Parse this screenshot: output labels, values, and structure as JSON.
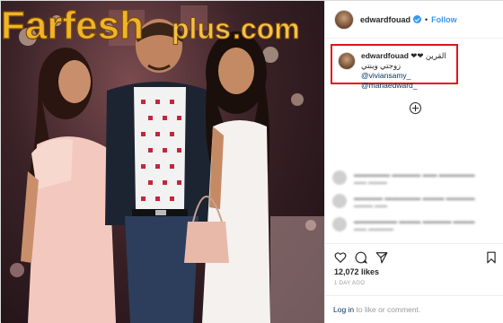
{
  "header": {
    "username": "edwardfouad",
    "separator": "•",
    "follow_label": "Follow"
  },
  "caption": {
    "username": "edwardfouad",
    "text": "القرين ❤❤ زوجتي وبنتي",
    "mention1": "@viviansamy_",
    "mention2": "@mariaedward_"
  },
  "comments": [
    {
      "text": "▬▬▬▬▬ ▬▬▬▬ ▬▬ ▬▬▬▬▬",
      "sub": "▬▬ ▬▬▬"
    },
    {
      "text": "▬▬▬▬ ▬▬▬▬▬ ▬▬▬ ▬▬▬▬",
      "sub": "▬▬▬ ▬▬"
    },
    {
      "text": "▬▬▬▬▬▬ ▬▬▬ ▬▬▬▬ ▬▬▬",
      "sub": "▬▬ ▬▬▬▬"
    }
  ],
  "likes": "12,072 likes",
  "posted": "1 DAY AGO",
  "login": {
    "login_label": "Log in",
    "rest": " to like or comment."
  },
  "watermark": {
    "brand": "Farfesh",
    "plus": "plus",
    "domain": ".com"
  },
  "colors": {
    "accent": "#3897f0",
    "highlight_box": "#e0161b",
    "watermark_gold": "#f0b429",
    "link": "#003569"
  }
}
